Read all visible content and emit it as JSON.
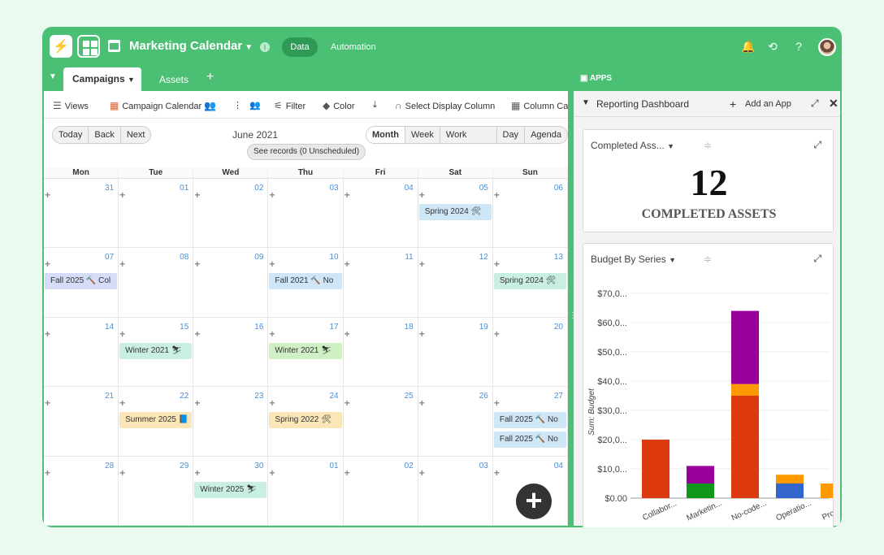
{
  "app": {
    "title": "Marketing Calendar",
    "modes": [
      "Data",
      "Automation"
    ],
    "colors": {
      "brand": "#4bbf73",
      "brand_dark": "#2f9a56"
    }
  },
  "tabs": {
    "active": "Campaigns",
    "other": "Assets",
    "add": "+"
  },
  "toolbar": {
    "views": "Views",
    "view_name": "Campaign Calendar",
    "filter": "Filter",
    "color": "Color",
    "select_display": "Select Display Column",
    "column": "Column Ca"
  },
  "nav": {
    "today": "Today",
    "back": "Back",
    "next": "Next",
    "month_label": "June 2021",
    "see_records": "See records (0 Unscheduled)",
    "views": [
      "Month",
      "Week",
      "Work Week",
      "Day",
      "Agenda"
    ],
    "active_view": "Month"
  },
  "calendar": {
    "weekdays": [
      "Mon",
      "Tue",
      "Wed",
      "Thu",
      "Fri",
      "Sat",
      "Sun"
    ],
    "weeks": [
      [
        "31",
        "01",
        "02",
        "03",
        "04",
        "05",
        "06"
      ],
      [
        "07",
        "08",
        "09",
        "10",
        "11",
        "12",
        "13"
      ],
      [
        "14",
        "15",
        "16",
        "17",
        "18",
        "19",
        "20"
      ],
      [
        "21",
        "22",
        "23",
        "24",
        "25",
        "26",
        "27"
      ],
      [
        "28",
        "29",
        "30",
        "01",
        "02",
        "03",
        "04"
      ]
    ],
    "events": [
      {
        "week": 0,
        "day": 5,
        "slot": 0,
        "label": "Spring 2024 🛠",
        "color": "#cfe6f7"
      },
      {
        "week": 1,
        "day": 0,
        "slot": 0,
        "label": "Fall 2025 🔨 Col",
        "color": "#d6dcf7"
      },
      {
        "week": 1,
        "day": 3,
        "slot": 0,
        "label": "Fall 2021 🔨 No",
        "color": "#cfe6f7"
      },
      {
        "week": 1,
        "day": 6,
        "slot": 0,
        "label": "Spring 2024 🛠",
        "color": "#c8efdf"
      },
      {
        "week": 2,
        "day": 1,
        "slot": 0,
        "label": "Winter 2021 ⛷",
        "color": "#c8efdf"
      },
      {
        "week": 2,
        "day": 3,
        "slot": 0,
        "label": "Winter 2021 ⛷",
        "color": "#cfefc4"
      },
      {
        "week": 3,
        "day": 1,
        "slot": 0,
        "label": "Summer 2025 📘",
        "color": "#fbe6b8"
      },
      {
        "week": 3,
        "day": 3,
        "slot": 0,
        "label": "Spring 2022 🛠",
        "color": "#fbe6b8"
      },
      {
        "week": 3,
        "day": 6,
        "slot": 0,
        "label": "Fall 2025 🔨 No",
        "color": "#cfe6f7"
      },
      {
        "week": 3,
        "day": 6,
        "slot": 1,
        "label": "Fall 2025 🔨 No",
        "color": "#cfe6f7"
      },
      {
        "week": 4,
        "day": 2,
        "slot": 0,
        "label": "Winter 2025 ⛷",
        "color": "#c8efdf"
      }
    ]
  },
  "apps": {
    "header": "APPS",
    "dashboard": "Reporting Dashboard",
    "add_app": "Add an App",
    "cards": {
      "completed": {
        "title": "Completed Ass...",
        "value": "12",
        "caption": "COMPLETED ASSETS"
      },
      "budget": {
        "title": "Budget By Series"
      }
    }
  },
  "chart_data": {
    "type": "bar",
    "stacked": true,
    "categories": [
      "Collabor...",
      "Marketin...",
      "No-code...",
      "Operatio...",
      "Product..."
    ],
    "ylabel": "Sum: Budget",
    "yticks": [
      "$0.00",
      "$10,0...",
      "$20,0...",
      "$30,0...",
      "$40,0...",
      "$50,0...",
      "$60,0...",
      "$70,0..."
    ],
    "ylim": [
      0,
      70000
    ],
    "series": [
      {
        "color": "#dd3a10",
        "values": [
          20000,
          0,
          35000,
          0,
          0
        ]
      },
      {
        "color": "#109618",
        "values": [
          0,
          5000,
          0,
          0,
          0
        ]
      },
      {
        "color": "#3366cc",
        "values": [
          0,
          0,
          0,
          5000,
          0
        ]
      },
      {
        "color": "#ff9900",
        "values": [
          0,
          0,
          4000,
          3000,
          5000
        ]
      },
      {
        "color": "#990099",
        "values": [
          0,
          6000,
          25000,
          0,
          0
        ]
      }
    ]
  }
}
